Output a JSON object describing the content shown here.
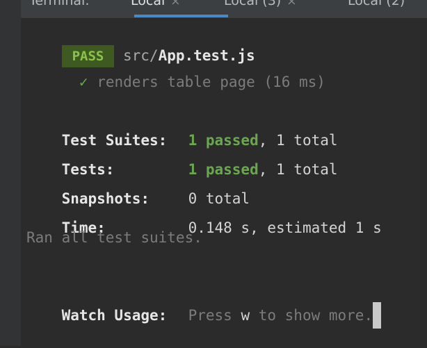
{
  "tabs": [
    {
      "label": "Terminal:",
      "closable": false
    },
    {
      "label": "Local",
      "closable": true,
      "active": true
    },
    {
      "label": "Local (3)",
      "closable": true
    },
    {
      "label": "Local (2)",
      "closable": false
    }
  ],
  "close_glyph": "×",
  "result": {
    "badge": "PASS",
    "path_dir": "src/",
    "path_file": "App.test.js",
    "check_glyph": "✓",
    "test_line": "renders table page (16 ms)"
  },
  "summary": {
    "suites_label": "Test Suites:",
    "suites_passed": "1 passed",
    "suites_rest": ", 1 total",
    "tests_label": "Tests:",
    "tests_passed": "1 passed",
    "tests_rest": ", 1 total",
    "snapshots_label": "Snapshots:",
    "snapshots_value": "0 total",
    "time_label": "Time:",
    "time_value": "0.148 s, estimated 1 s",
    "ran_all": "Ran all test suites."
  },
  "watch": {
    "label": "Watch Usage:",
    "press": "Press ",
    "key": "w",
    "rest": " to show more."
  },
  "colors": {
    "background": "#2b2b2b",
    "pass_badge_bg": "#3e5a21",
    "pass_text": "#8bc34a",
    "active_tab_underline": "#4a88c7"
  }
}
